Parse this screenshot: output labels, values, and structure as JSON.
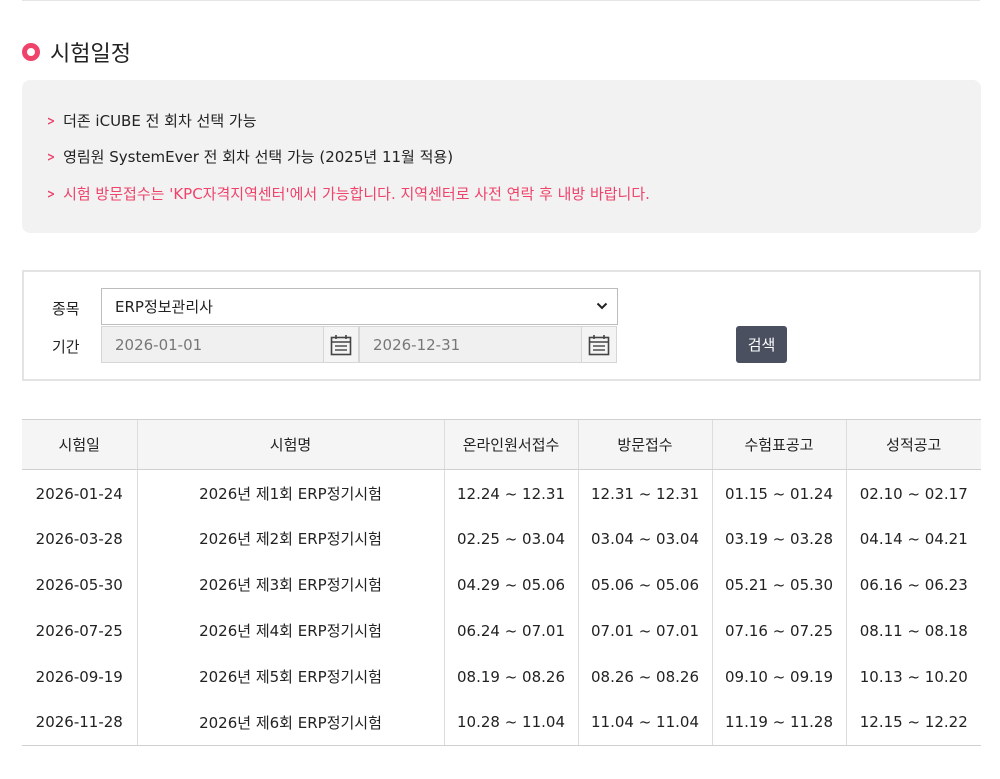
{
  "section": {
    "title": "시험일정"
  },
  "notices": [
    {
      "text": "더존 iCUBE 전 회차 선택 가능"
    },
    {
      "text": "영림원 SystemEver 전 회차 선택 가능 (2025년 11월 적용)"
    },
    {
      "text": "시험 방문접수는 'KPC자격지역센터'에서 가능합니다. 지역센터로 사전 연락 후 내방 바랍니다."
    }
  ],
  "search": {
    "subject_label": "종목",
    "subject_value": "ERP정보관리사",
    "period_label": "기간",
    "start_date": "2026-01-01",
    "end_date": "2026-12-31",
    "button_label": "검색"
  },
  "table": {
    "headers": [
      "시험일",
      "시험명",
      "온라인원서접수",
      "방문접수",
      "수험표공고",
      "성적공고"
    ],
    "rows": [
      [
        "2026-01-24",
        "2026년 제1회 ERP정기시험",
        "12.24 ~ 12.31",
        "12.31 ~ 12.31",
        "01.15 ~ 01.24",
        "02.10 ~ 02.17"
      ],
      [
        "2026-03-28",
        "2026년 제2회 ERP정기시험",
        "02.25 ~ 03.04",
        "03.04 ~ 03.04",
        "03.19 ~ 03.28",
        "04.14 ~ 04.21"
      ],
      [
        "2026-05-30",
        "2026년 제3회 ERP정기시험",
        "04.29 ~ 05.06",
        "05.06 ~ 05.06",
        "05.21 ~ 05.30",
        "06.16 ~ 06.23"
      ],
      [
        "2026-07-25",
        "2026년 제4회 ERP정기시험",
        "06.24 ~ 07.01",
        "07.01 ~ 07.01",
        "07.16 ~ 07.25",
        "08.11 ~ 08.18"
      ],
      [
        "2026-09-19",
        "2026년 제5회 ERP정기시험",
        "08.19 ~ 08.26",
        "08.26 ~ 08.26",
        "09.10 ~ 09.19",
        "10.13 ~ 10.20"
      ],
      [
        "2026-11-28",
        "2026년 제6회 ERP정기시험",
        "10.28 ~ 11.04",
        "11.04 ~ 11.04",
        "11.19 ~ 11.28",
        "12.15 ~ 12.22"
      ]
    ]
  },
  "colors": {
    "accent": "#f0436b",
    "button": "#4a5060",
    "panel_bg": "#f2f2f2"
  }
}
